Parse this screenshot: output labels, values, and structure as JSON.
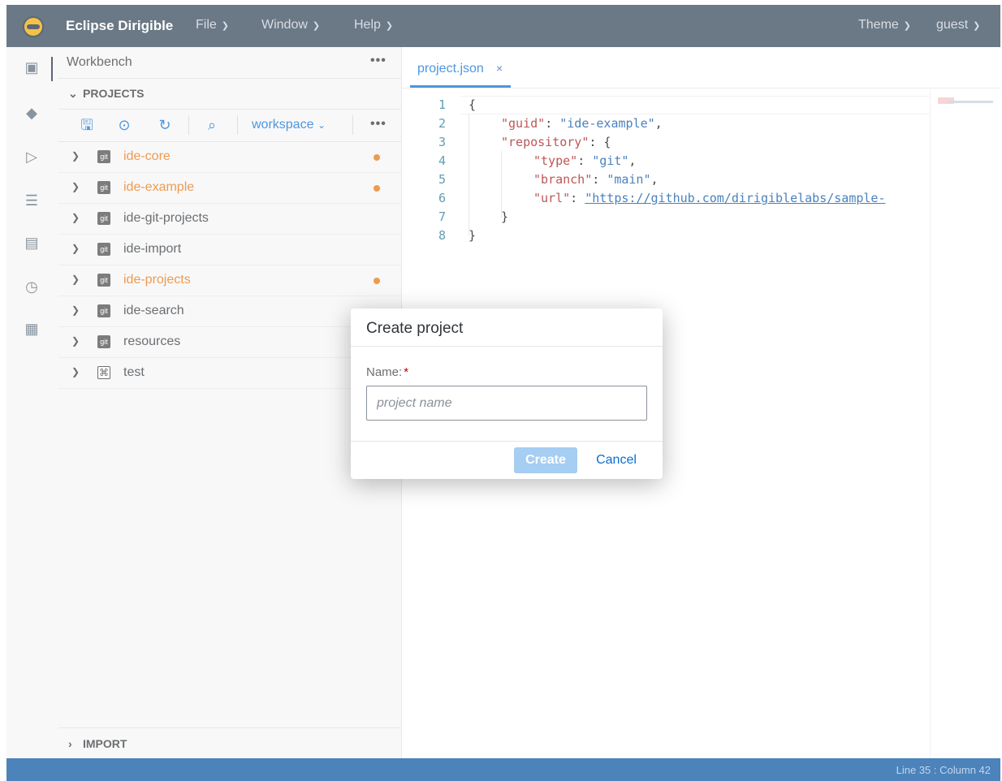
{
  "app": {
    "brand": "Eclipse Dirigible",
    "menus": [
      {
        "label": "File"
      },
      {
        "label": "Window"
      },
      {
        "label": "Help"
      }
    ],
    "right_menus": [
      {
        "label": "Theme"
      },
      {
        "label": "guest"
      }
    ]
  },
  "sidebar": {
    "title": "Workbench",
    "section_projects": "PROJECTS",
    "section_import": "IMPORT",
    "workspace_label": "workspace",
    "projects": [
      {
        "name": "ide-core",
        "icon": "git-icon",
        "modified": true
      },
      {
        "name": "ide-example",
        "icon": "git-icon",
        "modified": true
      },
      {
        "name": "ide-git-projects",
        "icon": "git-icon",
        "modified": false
      },
      {
        "name": "ide-import",
        "icon": "git-icon",
        "modified": false
      },
      {
        "name": "ide-projects",
        "icon": "git-icon",
        "modified": true
      },
      {
        "name": "ide-search",
        "icon": "git-icon",
        "modified": false
      },
      {
        "name": "resources",
        "icon": "git-icon",
        "modified": false
      },
      {
        "name": "test",
        "icon": "project-icon",
        "modified": false
      }
    ],
    "git_badge": "git"
  },
  "editor": {
    "tab_label": "project.json",
    "tab_close": "×",
    "lines": [
      "1",
      "2",
      "3",
      "4",
      "5",
      "6",
      "7",
      "8"
    ],
    "code": {
      "l1": "{",
      "guid_key": "\"guid\"",
      "guid_val": "\"ide-example\"",
      "repo_key": "\"repository\"",
      "type_key": "\"type\"",
      "type_val": "\"git\"",
      "branch_key": "\"branch\"",
      "branch_val": "\"main\"",
      "url_key": "\"url\"",
      "url_val": "\"https://github.com/dirigiblelabs/sample-",
      "close_inner": "}",
      "close_outer": "}"
    }
  },
  "statusbar": {
    "position": "Line 35 : Column 42"
  },
  "dialog": {
    "title": "Create project",
    "name_label": "Name:",
    "required_mark": "*",
    "placeholder": "project name",
    "create_label": "Create",
    "cancel_label": "Cancel"
  },
  "colors": {
    "topbar": "#324456",
    "accent": "#0a6ed1",
    "modified": "#e9730c",
    "statusbar": "#0854a0"
  }
}
